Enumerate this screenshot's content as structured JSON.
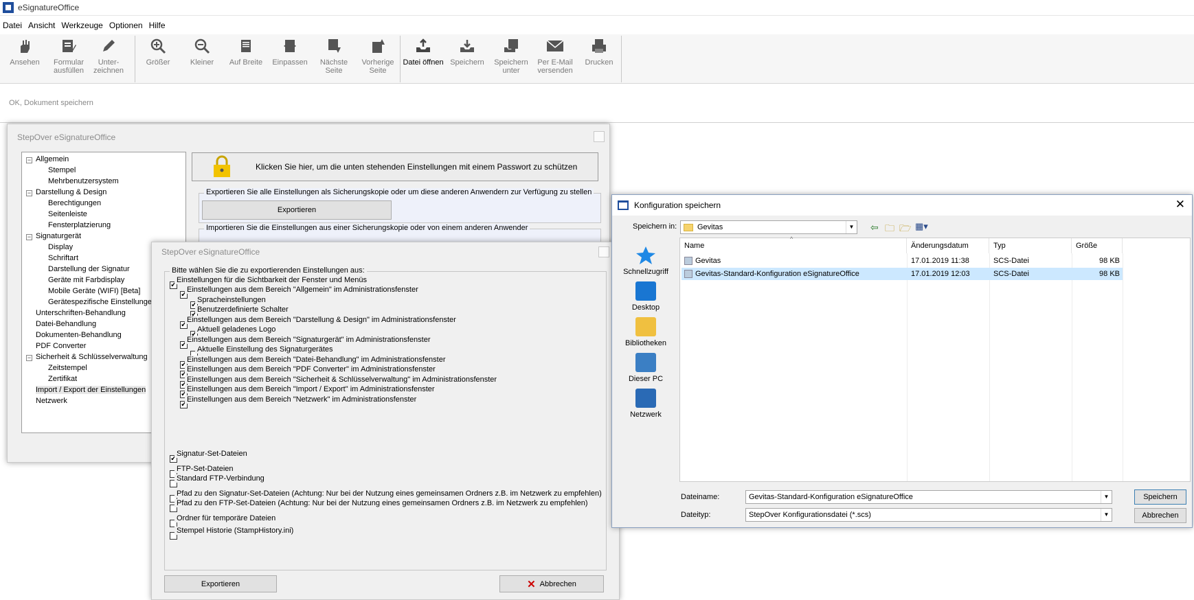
{
  "app": {
    "title": "eSignatureOffice"
  },
  "menu": [
    "Datei",
    "Ansicht",
    "Werkzeuge",
    "Optionen",
    "Hilfe"
  ],
  "toolbar": {
    "ansehen": "Ansehen",
    "formular": "Formular ausfüllen",
    "unterzeichnen": "Unter-zeichnen",
    "groesser": "Größer",
    "kleiner": "Kleiner",
    "aufbreite": "Auf Breite",
    "einpassen": "Einpassen",
    "naechste": "Nächste Seite",
    "vorherige": "Vorherige Seite",
    "oeffnen": "Datei öffnen",
    "speichern": "Speichern",
    "speichernunter": "Speichern unter",
    "email": "Per E-Mail versenden",
    "drucken": "Drucken"
  },
  "status": "OK, Dokument speichern",
  "settings_window": {
    "title": "StepOver eSignatureOffice",
    "tree": [
      "Allgemein",
      "Stempel",
      "Mehrbenutzersystem",
      "Darstellung & Design",
      "Berechtigungen",
      "Seitenleiste",
      "Fensterplatzierung",
      "Signaturgerät",
      "Display",
      "Schriftart",
      "Darstellung der Signatur",
      "Geräte mit Farbdisplay",
      "Mobile Geräte (WIFI) [Beta]",
      "Gerätespezifische Einstellungen",
      "Unterschriften-Behandlung",
      "Datei-Behandlung",
      "Dokumenten-Behandlung",
      "PDF Converter",
      "Sicherheit & Schlüsselverwaltung",
      "Zeitstempel",
      "Zertifikat",
      "Import / Export der Einstellungen",
      "Netzwerk"
    ],
    "lock_text": "Klicken Sie hier, um die unten stehenden Einstellungen mit einem Passwort zu schützen",
    "export_group": "Exportieren Sie alle Einstellungen als Sicherungskopie oder um diese anderen Anwendern zur Verfügung zu stellen",
    "export_button": "Exportieren",
    "import_group": "Importieren Sie die Einstellungen aus einer Sicherungskopie oder von einem anderen Anwender"
  },
  "export_dialog": {
    "title": "StepOver eSignatureOffice",
    "group": "Bitte wählen Sie die zu exportierenden Einstellungen aus:",
    "items": [
      {
        "label": "Einstellungen für die Sichtbarkeit der Fenster und Menüs",
        "checked": true
      },
      {
        "label": "Einstellungen aus dem Bereich \"Allgemein\" im Administrationsfenster",
        "checked": true
      },
      {
        "label": "Spracheinstellungen",
        "checked": true
      },
      {
        "label": "Benutzerdefinierte Schalter",
        "checked": true
      },
      {
        "label": "Einstellungen aus dem Bereich \"Darstellung & Design\" im Administrationsfenster",
        "checked": true
      },
      {
        "label": "Aktuell geladenes Logo",
        "checked": true
      },
      {
        "label": "Einstellungen aus dem Bereich \"Signaturgerät\" im Administrationsfenster",
        "checked": true
      },
      {
        "label": "Aktuelle Einstellung des Signaturgerätes",
        "checked": false
      },
      {
        "label": "Einstellungen aus dem Bereich \"Datei-Behandlung\" im Administrationsfenster",
        "checked": true
      },
      {
        "label": "Einstellungen aus dem Bereich \"PDF Converter\" im Administrationsfenster",
        "checked": true
      },
      {
        "label": "Einstellungen aus dem Bereich \"Sicherheit & Schlüsselverwaltung\" im Administrationsfenster",
        "checked": true
      },
      {
        "label": "Einstellungen aus dem Bereich \"Import / Export\" im Administrationsfenster",
        "checked": true
      },
      {
        "label": "Einstellungen aus dem Bereich \"Netzwerk\" im Administrationsfenster",
        "checked": true
      },
      {
        "label": "Signatur-Set-Dateien",
        "checked": true
      },
      {
        "label": "FTP-Set-Dateien",
        "checked": false
      },
      {
        "label": "Standard FTP-Verbindung",
        "checked": false
      },
      {
        "label": "Pfad zu den Signatur-Set-Dateien (Achtung: Nur bei der Nutzung eines gemeinsamen Ordners z.B. im Netzwerk zu empfehlen)",
        "checked": false
      },
      {
        "label": "Pfad zu den FTP-Set-Dateien (Achtung: Nur bei der Nutzung eines gemeinsamen Ordners z.B. im Netzwerk zu empfehlen)",
        "checked": false
      },
      {
        "label": "Ordner für temporäre Dateien",
        "checked": false
      },
      {
        "label": "Stempel Historie (StampHistory.ini)",
        "checked": false
      }
    ],
    "export_button": "Exportieren",
    "cancel_button": "Abbrechen"
  },
  "save_dialog": {
    "title": "Konfiguration speichern",
    "save_in_label": "Speichern in:",
    "save_in_value": "Gevitas",
    "places": [
      "Schnellzugriff",
      "Desktop",
      "Bibliotheken",
      "Dieser PC",
      "Netzwerk"
    ],
    "columns": [
      "Name",
      "Änderungsdatum",
      "Typ",
      "Größe"
    ],
    "files": [
      {
        "name": "Gevitas",
        "date": "17.01.2019 11:38",
        "type": "SCS-Datei",
        "size": "98 KB"
      },
      {
        "name": "Gevitas-Standard-Konfiguration eSignatureOffice",
        "date": "17.01.2019 12:03",
        "type": "SCS-Datei",
        "size": "98 KB"
      }
    ],
    "filename_label": "Dateiname:",
    "filename_value": "Gevitas-Standard-Konfiguration eSignatureOffice",
    "filetype_label": "Dateityp:",
    "filetype_value": "StepOver Konfigurationsdatei (*.scs)",
    "save_button": "Speichern",
    "cancel_button": "Abbrechen"
  }
}
